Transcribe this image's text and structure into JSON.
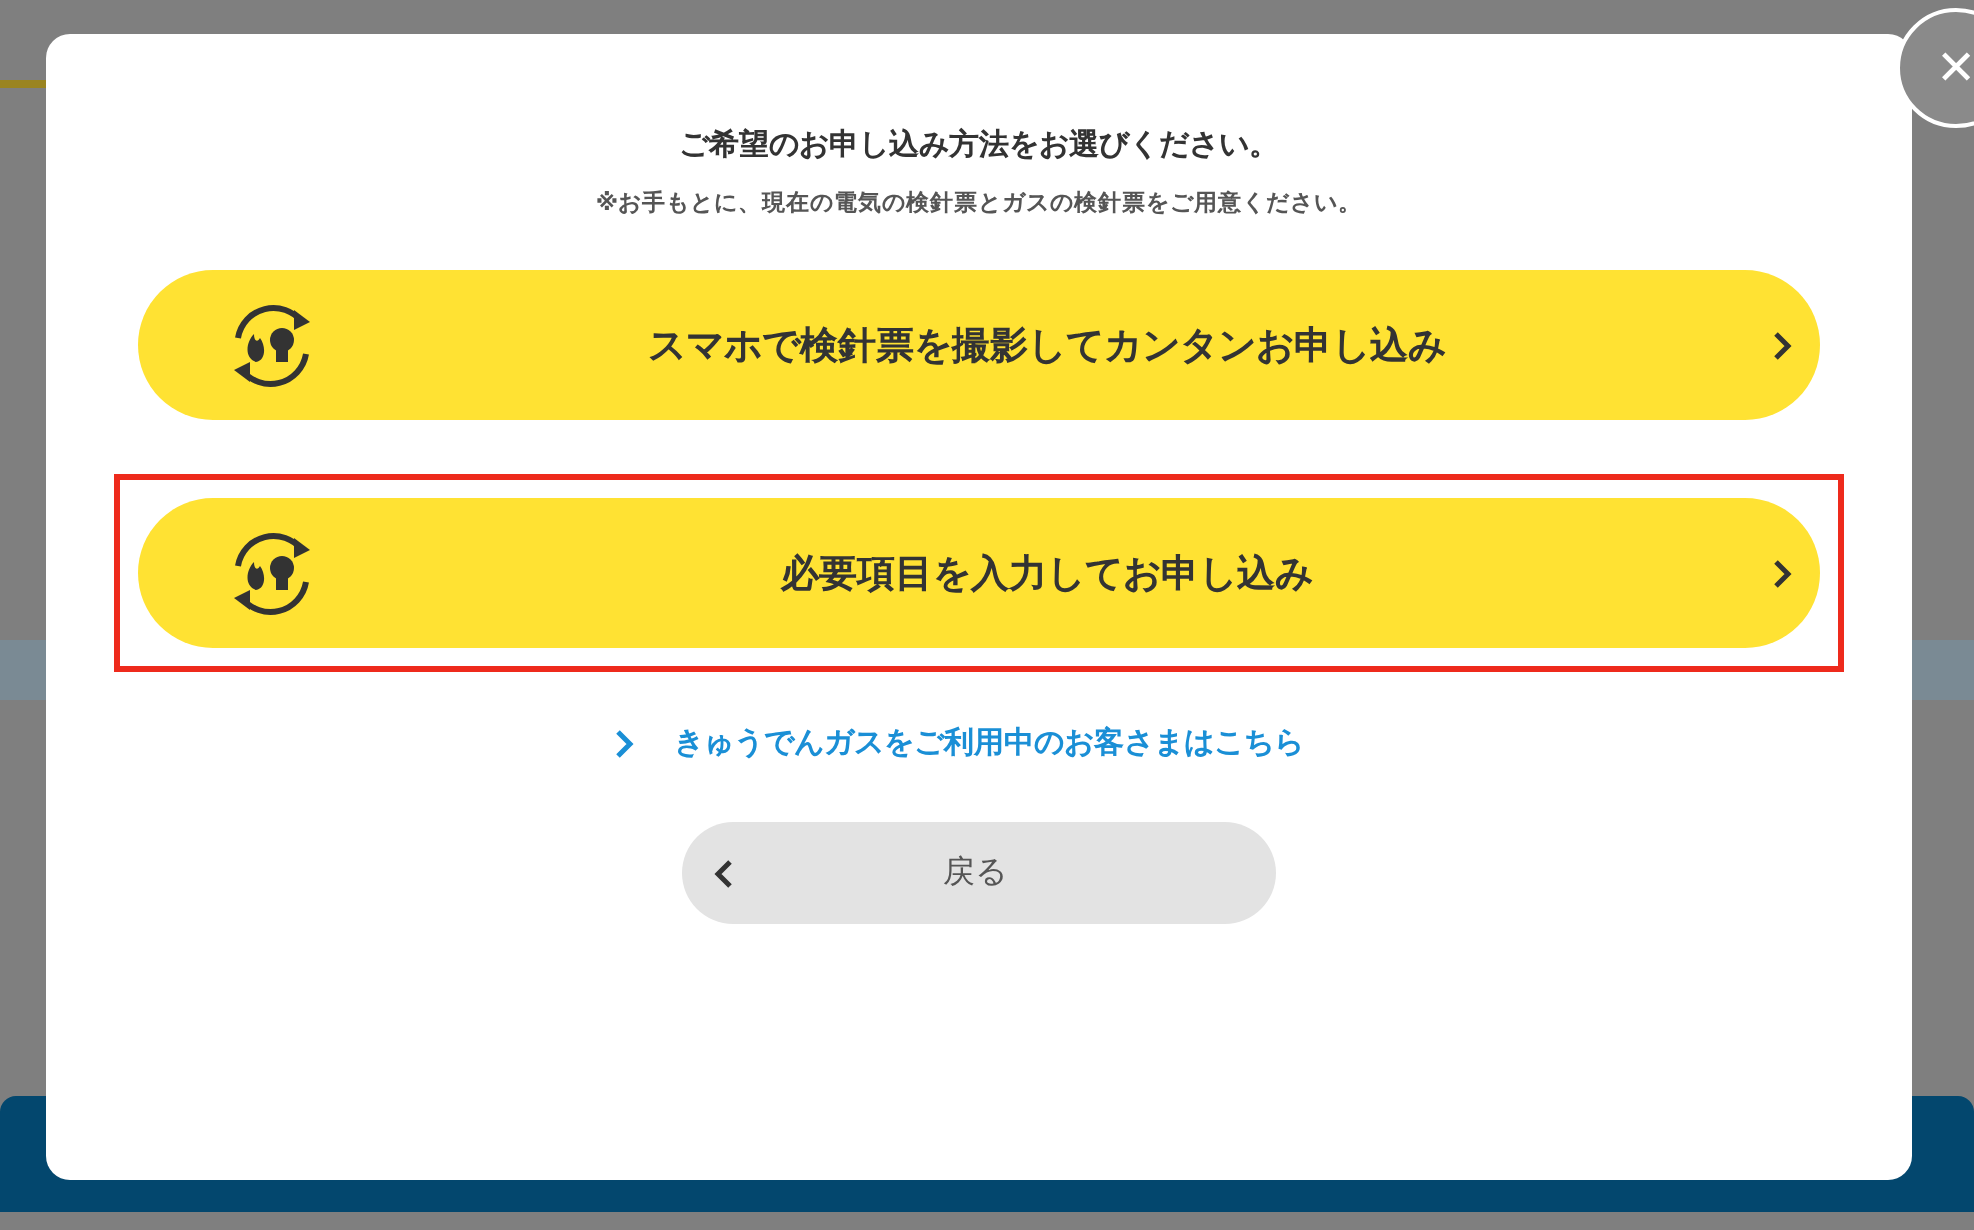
{
  "dialog": {
    "title": "ご希望のお申し込み方法をお選びください。",
    "note": "※お手もとに、現在の電気の検針票とガスの検針票をご用意ください。",
    "options": [
      {
        "label": "スマホで検針票を撮影してカンタンお申し込み",
        "highlighted": false
      },
      {
        "label": "必要項目を入力してお申し込み",
        "highlighted": true
      }
    ],
    "link": "きゅうでんガスをご利用中のお客さまはこちら",
    "back_button": "戻る",
    "close_button": "✕"
  }
}
